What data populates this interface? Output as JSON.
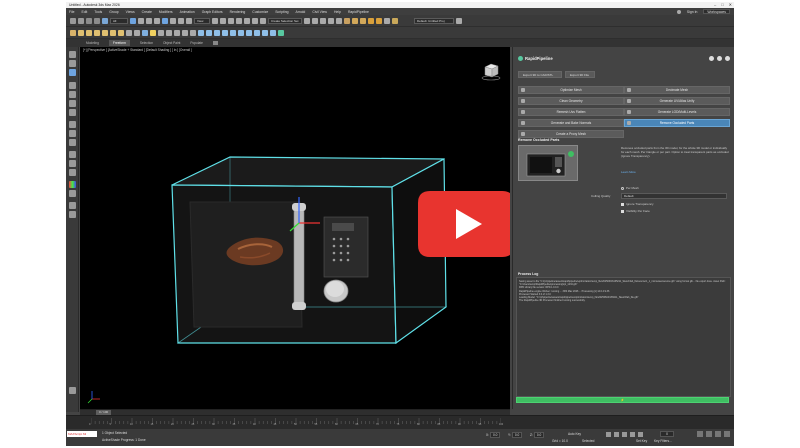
{
  "title_bar": {
    "title": "Untitled - Autodesk 3ds Max 2026",
    "minimize": "–",
    "maximize": "□",
    "close": "✕"
  },
  "menu": {
    "items": [
      "File",
      "Edit",
      "Tools",
      "Group",
      "Views",
      "Create",
      "Modifiers",
      "Animation",
      "Graph Editors",
      "Rendering",
      "Customize",
      "Scripting",
      "Arnold",
      "Civil View",
      "Help",
      "RapidPipeline"
    ],
    "user": "Sign In",
    "workspace": "Workspaces"
  },
  "toolbar": {
    "filter_label": "All",
    "view_label": "View",
    "selection_set_label": "Create Selection Set",
    "project_label": "Default: Untitled Proj"
  },
  "ribbon_tabs": [
    "Modeling",
    "Freeform",
    "Selection",
    "Object Paint",
    "Populate"
  ],
  "viewport": {
    "label": "[+] [Perspective ] [ActiveShade + Standard ] [Default Shading ] [ In ] [Overall ]"
  },
  "panel": {
    "brand": "RapidPipeline",
    "top_buttons": [
      "Export 3D to CAD/STL",
      "Export 3D File"
    ],
    "tools": [
      {
        "label": "Optimize Mesh",
        "selected": false
      },
      {
        "label": "Decimate Mesh",
        "selected": false
      },
      {
        "label": "Clean Geometry",
        "selected": false
      },
      {
        "label": "Generate UV/Atlas Unify",
        "selected": false
      },
      {
        "label": "Remesh Uvs Flatten",
        "selected": false
      },
      {
        "label": "Generate LOD/Multi-Levels",
        "selected": false
      },
      {
        "label": "Generate and Bake Normals",
        "selected": false
      },
      {
        "label": "Remove Occluded Parts",
        "selected": true
      },
      {
        "label": "Create a Proxy Mesh",
        "selected": false
      }
    ],
    "section_title": "Remove Occluded Parts",
    "description": "Removes occluded parts from the 3D model, for the whole 3D model or individually for each mesh. Per triangle or per part. Option to treat transparent parts as occluded (Ignore Transparency).",
    "learn_more": "Learn More",
    "per_mesh": "Per Mesh",
    "culling_quality_label": "Culling Quality",
    "culling_quality_value": "Default",
    "ignore_transparency": "Ignore Transparency",
    "visibility_per_face": "Visibility Per Face",
    "log_title": "Process Log",
    "log_text": "Saving asset to file \"C:\\rpi\\pipeline\\assets\\rapid\\pipeline\\optimization\\temp_file\\20250604\\165211_Sketchfab_file\\source\\1_1_microwave\\source.glb\" using format glb... file export done. Asset Path: \"C:\\Users\\temp\\RapidPipeline\\processing\\rpi_1234.glb\"\nRPD Library file version: RPD.1.0.0.0\nRapidPipeline engine Worker: running ... 3DS Max 2026 ... Processing [c] 14.0.4.9.36\nProcessor Started 3.0 of 1.3.0\nLoading Model: \"C:\\rpi\\pipeline\\assets\\rapid\\pipeline\\optimization\\temp_file\\20250604\\165211_Sketchfab_file.glb\"\nThe RapidPipeline 3D Processor finished running successfully.",
    "run_label": "⚡"
  },
  "timeline": {
    "position": "0 / 100",
    "ticks": [
      "0",
      "5",
      "10",
      "15",
      "20",
      "25",
      "30",
      "35",
      "40",
      "45",
      "50",
      "55",
      "60",
      "65",
      "70",
      "75",
      "80",
      "85",
      "90",
      "95",
      "100"
    ]
  },
  "status": {
    "maxscript": "MAXScript Mi",
    "selection": "1 Object Selected",
    "prompt": "ActiveShade Progress: 1 Done",
    "x_label": "X:",
    "x_value": "0.0",
    "y_label": "Y:",
    "y_value": "0.0",
    "z_label": "Z:",
    "z_value": "0.0",
    "grid": "Grid = 10.0",
    "auto_key": "Auto Key",
    "selected_label": "Selected",
    "set_key": "Set Key",
    "key_filters": "Key Filters...",
    "frame": "0"
  },
  "colors": {
    "accent_green": "#3fbe62",
    "selection_blue": "#4a86b8",
    "play_red": "#e8342f",
    "bbox_cyan": "#5fe0e8"
  }
}
